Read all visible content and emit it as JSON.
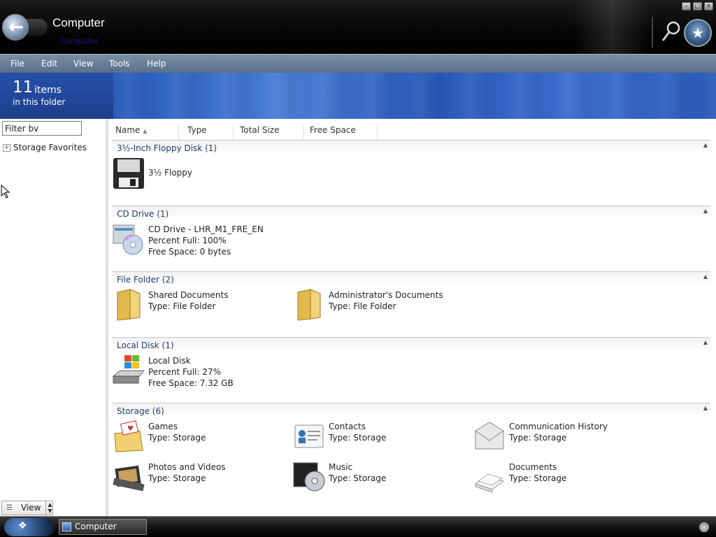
{
  "window": {
    "title": "Computer",
    "subtitle": "Computer"
  },
  "menu": [
    "File",
    "Edit",
    "View",
    "Tools",
    "Help"
  ],
  "banner": {
    "count": "11",
    "count_word": "items",
    "sub": "in this folder"
  },
  "left_pane": {
    "filter_value": "Filter bv",
    "favorites": "Storage Favorites",
    "view_label": "View"
  },
  "columns": [
    "Name",
    "Type",
    "Total Size",
    "Free Space"
  ],
  "groups": [
    {
      "title": "3½-Inch Floppy Disk (1)",
      "items": [
        {
          "icon": "floppy-disk-icon",
          "lines": [
            "3½ Floppy"
          ]
        }
      ]
    },
    {
      "title": "CD Drive (1)",
      "items": [
        {
          "icon": "cd-drive-icon",
          "lines": [
            "CD Drive - LHR_M1_FRE_EN",
            "Percent Full: 100%",
            "Free Space: 0 bytes"
          ]
        }
      ]
    },
    {
      "title": "File Folder (2)",
      "items": [
        {
          "icon": "folder-icon",
          "lines": [
            "Shared Documents",
            "Type: File Folder"
          ]
        },
        {
          "icon": "folder-icon",
          "lines": [
            "Administrator's Documents",
            "Type: File Folder"
          ]
        }
      ]
    },
    {
      "title": "Local Disk (1)",
      "items": [
        {
          "icon": "local-disk-icon",
          "lines": [
            "Local Disk",
            "Percent Full: 27%",
            "Free Space: 7.32 GB"
          ]
        }
      ]
    },
    {
      "title": "Storage (6)",
      "items": [
        {
          "icon": "games-icon",
          "lines": [
            "Games",
            "Type: Storage"
          ]
        },
        {
          "icon": "contacts-icon",
          "lines": [
            "Contacts",
            "Type: Storage"
          ]
        },
        {
          "icon": "communication-history-icon",
          "lines": [
            "Communication History",
            "Type: Storage"
          ]
        },
        {
          "icon": "photos-videos-icon",
          "lines": [
            "Photos and Videos",
            "Type: Storage"
          ]
        },
        {
          "icon": "music-icon",
          "lines": [
            "Music",
            "Type: Storage"
          ]
        },
        {
          "icon": "documents-icon",
          "lines": [
            "Documents",
            "Type: Storage"
          ]
        }
      ]
    }
  ],
  "taskbar": {
    "task_label": "Computer"
  },
  "colors": {
    "banner": "#2c60c0",
    "menubar": "#6a8098",
    "group_text": "#1f3d6e"
  }
}
